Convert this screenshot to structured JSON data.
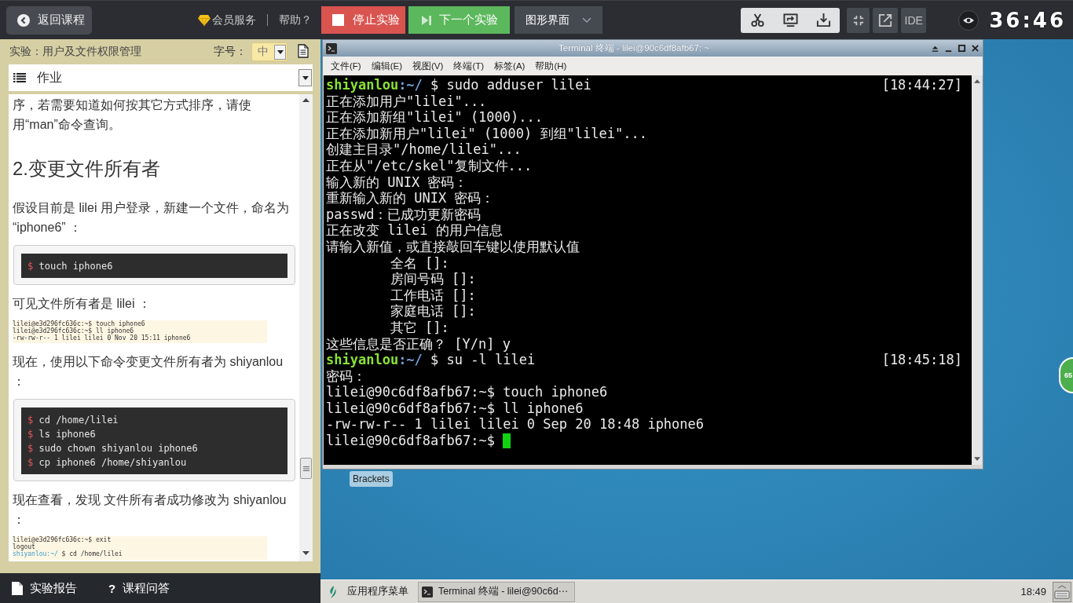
{
  "top_bar": {
    "back_button": "返回课程",
    "vip_link": "会员服务",
    "help_link": "帮助？",
    "stop_button": "停止实验",
    "next_button": "下一个实验",
    "view_select": "图形界面",
    "ide_button": "IDE",
    "timer": "36:46"
  },
  "lab_panel": {
    "title": "实验：用户及文件权限管理",
    "font_size_label": "字号：",
    "font_size_value": "中",
    "section_select": "作业",
    "content": [
      {
        "kind": "paragraph",
        "text": "序，若需要知道如何按其它方式排序，请使用“man”命令查询。"
      },
      {
        "kind": "heading",
        "text": "2.变更文件所有者"
      },
      {
        "kind": "paragraph",
        "text": "假设目前是 lilei 用户登录，新建一个文件，命名为 “iphone6” ："
      },
      {
        "kind": "code",
        "lines": [
          {
            "prompt": "$",
            "command": "touch iphone6"
          }
        ]
      },
      {
        "kind": "paragraph",
        "text": "可见文件所有者是 lilei ："
      },
      {
        "kind": "screenshot",
        "lines": [
          {
            "text": "lilei@e3d296fc636c:~$ touch iphone6"
          },
          {
            "text": "lilei@e3d296fc636c:~$ ll iphone6"
          },
          {
            "text": "-rw-rw-r-- 1 lilei lilei 0 Nov 20 15:11 iphone6"
          }
        ]
      },
      {
        "kind": "paragraph",
        "text": "现在，使用以下命令变更文件所有者为 shiyanlou ："
      },
      {
        "kind": "code",
        "lines": [
          {
            "prompt": "$",
            "command": "cd /home/lilei"
          },
          {
            "prompt": "$",
            "command": "ls iphone6"
          },
          {
            "prompt": "$",
            "command": "sudo chown shiyanlou iphone6"
          },
          {
            "prompt": "$",
            "command": "cp iphone6 /home/shiyanlou"
          }
        ]
      },
      {
        "kind": "paragraph",
        "text": "现在查看，发现 文件所有者成功修改为 shiyanlou ："
      },
      {
        "kind": "screenshot",
        "lines": [
          {
            "text": "lilei@e3d296fc636c:~$ exit"
          },
          {
            "text": "logout"
          },
          {
            "prompt": "shiyanlou:~/",
            "text": "$ cd /home/lilei"
          }
        ]
      }
    ]
  },
  "bottom_bar": {
    "links": [
      {
        "kind": "report",
        "label": "实验报告"
      },
      {
        "kind": "qa",
        "icon": "?",
        "label": "课程问答"
      }
    ]
  },
  "desktop": {
    "terminal": {
      "title": "Terminal 终端 - lilei@90c6df8afb67: ~",
      "menu": [
        "文件(F)",
        "编辑(E)",
        "视图(V)",
        "终端(T)",
        "标签(A)",
        "帮助(H)"
      ],
      "lines": [
        {
          "kind": "prompt",
          "user": "shiyanlou",
          "path": ":~/",
          "command": "$ sudo adduser lilei",
          "time": "[18:44:27]",
          "cursor": false
        },
        {
          "kind": "output",
          "text": "正在添加用户\"lilei\"...",
          "cursor": false
        },
        {
          "kind": "output",
          "text": "正在添加新组\"lilei\" (1000)...",
          "cursor": false
        },
        {
          "kind": "output",
          "text": "正在添加新用户\"lilei\" (1000) 到组\"lilei\"...",
          "cursor": false
        },
        {
          "kind": "output",
          "text": "创建主目录\"/home/lilei\"...",
          "cursor": false
        },
        {
          "kind": "output",
          "text": "正在从\"/etc/skel\"复制文件...",
          "cursor": false
        },
        {
          "kind": "output",
          "text": "输入新的 UNIX 密码：",
          "cursor": false
        },
        {
          "kind": "output",
          "text": "重新输入新的 UNIX 密码：",
          "cursor": false
        },
        {
          "kind": "output",
          "text": "passwd：已成功更新密码",
          "cursor": false
        },
        {
          "kind": "output",
          "text": "正在改变 lilei 的用户信息",
          "cursor": false
        },
        {
          "kind": "output",
          "text": "请输入新值，或直接敲回车键以使用默认值",
          "cursor": false
        },
        {
          "kind": "field",
          "text": "全名 []:",
          "cursor": false
        },
        {
          "kind": "field",
          "text": "房间号码 []:",
          "cursor": false
        },
        {
          "kind": "field",
          "text": "工作电话 []:",
          "cursor": false
        },
        {
          "kind": "field",
          "text": "家庭电话 []:",
          "cursor": false
        },
        {
          "kind": "field",
          "text": "其它 []:",
          "cursor": false
        },
        {
          "kind": "output",
          "text": "这些信息是否正确？ [Y/n] y",
          "cursor": false
        },
        {
          "kind": "prompt",
          "user": "shiyanlou",
          "path": ":~/",
          "command": "$ su -l lilei",
          "time": "[18:45:18]",
          "cursor": false
        },
        {
          "kind": "output",
          "text": "密码：",
          "cursor": false
        },
        {
          "kind": "output",
          "text": "lilei@90c6df8afb67:~$ touch iphone6",
          "cursor": false
        },
        {
          "kind": "output",
          "text": "lilei@90c6df8afb67:~$ ll iphone6",
          "cursor": false
        },
        {
          "kind": "output",
          "text": "-rw-rw-r-- 1 lilei lilei 0 Sep 20 18:48 iphone6",
          "cursor": false
        },
        {
          "kind": "output",
          "text": "lilei@90c6df8afb67:~$",
          "cursor": true
        }
      ]
    },
    "icons": [
      {
        "label": "Brackets"
      }
    ],
    "side_badge": "65",
    "taskbar": {
      "app_menu": "应用程序菜单",
      "tasks": [
        {
          "label": "Terminal 终端 - lilei@90c6d⋯",
          "selected": true
        }
      ],
      "clock": "18:49"
    }
  }
}
